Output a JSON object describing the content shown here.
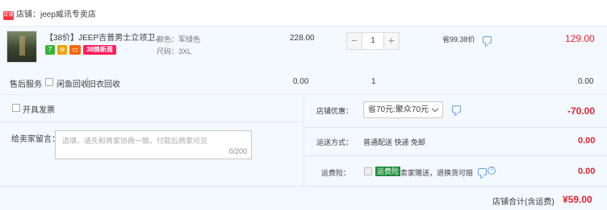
{
  "shop": {
    "badge": "店铺",
    "name": "店铺：jeep威讯专卖店"
  },
  "item": {
    "title": "【38价】JEEP吉普男士立领卫...",
    "tags": [
      "7",
      "⊕",
      "▭",
      "38焕新周"
    ],
    "color_attr": "颜色：军绿色",
    "size_attr": "尺码：3XL",
    "unit_price": "228.00",
    "quantity": "1",
    "discount_note": "省99.38价",
    "subtotal": "129.00"
  },
  "services": {
    "label": "售后服务",
    "options": [
      "闲鱼回收",
      "旧衣回收"
    ],
    "price": "0.00",
    "quantity": "1",
    "subtotal": "0.00"
  },
  "invoice": {
    "label": "开具发票"
  },
  "discount": {
    "label": "店铺优惠：",
    "selected": "省70元:聚众70元",
    "amount": "-70.00"
  },
  "message": {
    "label": "给卖家留言：",
    "placeholder": "选填，请先和商家协商一致，付款后商家可见",
    "count": "0/200"
  },
  "shipping": {
    "label": "运送方式：",
    "method": "普通配送 快递 免邮",
    "amount": "0.00"
  },
  "insurance": {
    "label": "运费险：",
    "tag": "运费险",
    "text": "卖家赠送，退换货可赔",
    "amount": "0.00"
  },
  "total": {
    "label": "店铺合计(含运费)",
    "amount": "¥59.00"
  },
  "colors": {
    "accent_red": "#e5232f",
    "panel_bg": "#f4f8ff",
    "badge_pink": "#ff1e5c",
    "insurance_green": "#1b8e3a"
  }
}
